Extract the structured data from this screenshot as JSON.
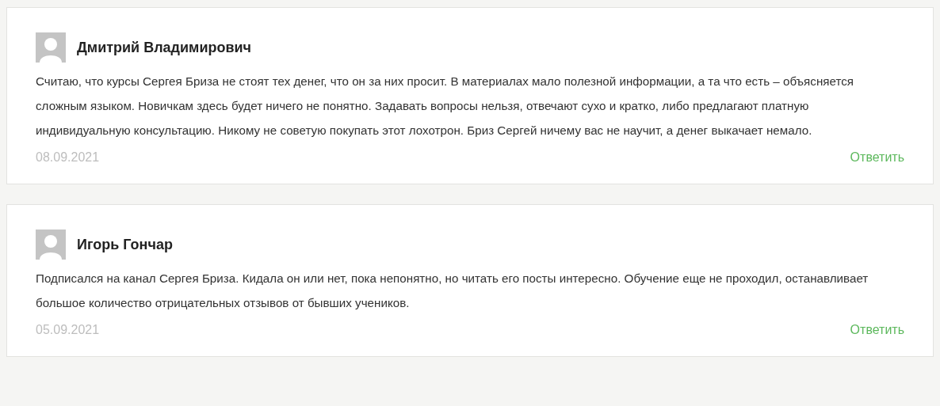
{
  "comments": [
    {
      "author": "Дмитрий Владимирович",
      "text": "Считаю, что курсы Сергея Бриза не стоят тех денег, что он за них просит. В материалах мало полезной информации, а та что есть – объясняется сложным языком. Новичкам здесь будет ничего не понятно. Задавать вопросы нельзя, отвечают сухо и кратко, либо предлагают платную индивидуальную консультацию. Никому не советую покупать этот лохотрон. Бриз Сергей ничему вас не научит, а денег выкачает немало.",
      "date": "08.09.2021",
      "reply": "Ответить"
    },
    {
      "author": "Игорь Гончар",
      "text": "Подписался на канал Сергея Бриза. Кидала он или нет, пока непонятно, но читать его посты интересно. Обучение еще не проходил, останавливает большое количество отрицательных отзывов от бывших учеников.",
      "date": "05.09.2021",
      "reply": "Ответить"
    }
  ]
}
